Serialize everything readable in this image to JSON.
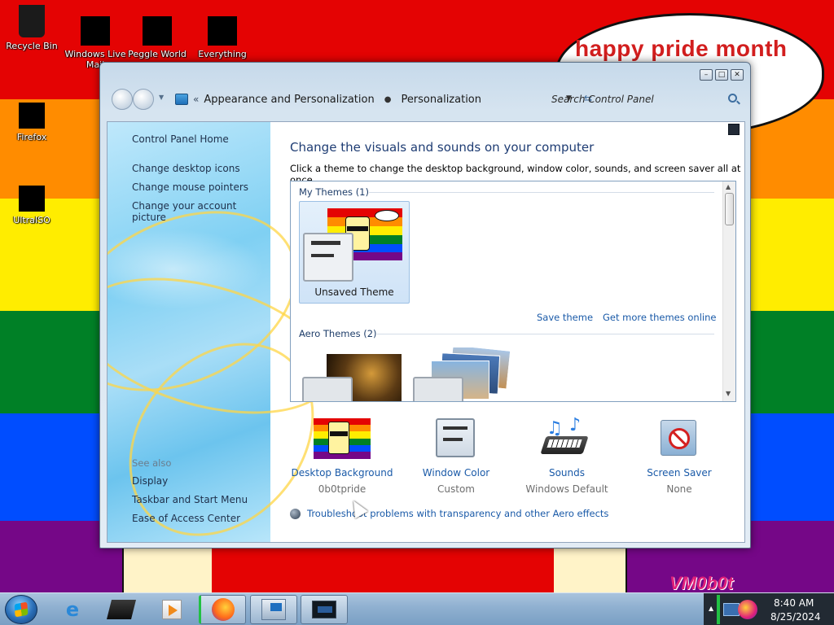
{
  "desktop": {
    "bubble_text": "happy pride month",
    "watermark": "VM0b0t",
    "icons": [
      {
        "label": "Recycle Bin"
      },
      {
        "label": "Windows Live Mail"
      },
      {
        "label": "Peggle World"
      },
      {
        "label": "Everything"
      },
      {
        "label": "Firefox"
      },
      {
        "label": "UltraISO"
      }
    ],
    "colors": {
      "red": "#e40303",
      "orange": "#ff8c00",
      "yellow": "#ffed00",
      "green": "#008026",
      "blue": "#004dff",
      "purple": "#750787"
    }
  },
  "window": {
    "controls": [
      "minimize-icon",
      "maximize-icon",
      "close-icon"
    ],
    "breadcrumb": {
      "chevron": "«",
      "items": [
        "Appearance and Personalization",
        "Personalization"
      ]
    },
    "search": {
      "placeholder": "Search Control Panel"
    },
    "left_pane": {
      "links": [
        "Control Panel Home",
        "Change desktop icons",
        "Change mouse pointers",
        "Change your account picture"
      ],
      "see_also": "See also",
      "see_also_links": [
        "Display",
        "Taskbar and Start Menu",
        "Ease of Access Center"
      ]
    },
    "main": {
      "title": "Change the visuals and sounds on your computer",
      "description": "Click a theme to change the desktop background, window color, sounds, and screen saver all at once.",
      "my_themes_header": "My Themes (1)",
      "selected_theme": "Unsaved Theme",
      "save_theme": "Save theme",
      "get_more": "Get more themes online",
      "aero_themes_header": "Aero Themes (2)",
      "options": [
        {
          "label": "Desktop Background",
          "value": "0b0tpride"
        },
        {
          "label": "Window Color",
          "value": "Custom"
        },
        {
          "label": "Sounds",
          "value": "Windows Default"
        },
        {
          "label": "Screen Saver",
          "value": "None"
        }
      ],
      "troubleshoot": "Troubleshoot problems with transparency and other Aero effects"
    }
  },
  "taskbar": {
    "time": "8:40 AM",
    "date": "8/25/2024",
    "pinned": [
      "internet-explorer-icon",
      "media-folder-icon",
      "media-player-icon",
      "firefox-icon",
      "control-panel-icon",
      "display-window-icon"
    ]
  }
}
